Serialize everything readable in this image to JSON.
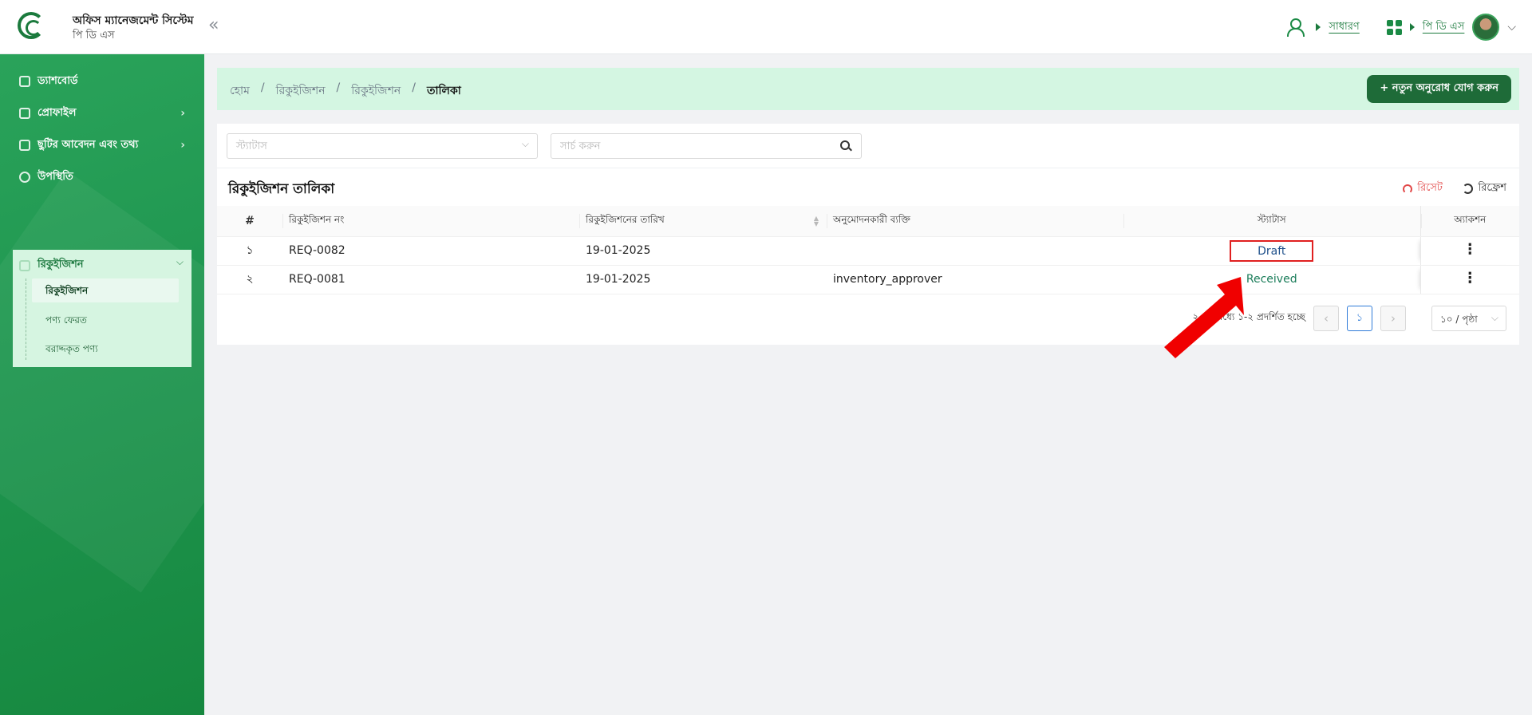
{
  "header": {
    "app_title": "অফিস ম্যানেজমেন্ট সিস্টেম",
    "app_subtitle": "পি ডি এস",
    "role_link": "সাধারণ",
    "module_link": "পি ডি এস"
  },
  "sidebar": {
    "items": [
      {
        "label": "ড্যাশবোর্ড"
      },
      {
        "label": "প্রোফাইল"
      },
      {
        "label": "ছুটির আবেদন এবং তথ্য"
      },
      {
        "label": "উপস্থিতি"
      },
      {
        "label": "রিকুইজিশন"
      }
    ],
    "sub_items": [
      {
        "label": "রিকুইজিশন"
      },
      {
        "label": "পণ্য ফেরত"
      },
      {
        "label": "বরাদ্দকৃত পণ্য"
      }
    ]
  },
  "breadcrumb": [
    "হোম",
    "রিকুইজিশন",
    "রিকুইজিশন",
    "তালিকা"
  ],
  "breadcrumb_sep": "/",
  "add_button": "+ নতুন অনুরোধ যোগ করুন",
  "filters": {
    "status_placeholder": "স্ট্যাটাস",
    "search_placeholder": "সার্চ করুন"
  },
  "card": {
    "title": "রিকুইজিশন তালিকা",
    "reset_label": "রিসেট",
    "refresh_label": "রিফ্রেশ"
  },
  "table": {
    "columns": [
      "#",
      "রিকুইজিশন নং",
      "রিকুইজিশনের তারিখ",
      "অনুমোদনকারী ব্যক্তি",
      "স্ট্যাটাস",
      "অ্যাকশন"
    ],
    "rows": [
      {
        "num": "১",
        "req_no": "REQ-0082",
        "date": "19-01-2025",
        "approver": "",
        "status": "Draft"
      },
      {
        "num": "২",
        "req_no": "REQ-0081",
        "date": "19-01-2025",
        "approver": "inventory_approver",
        "status": "Received"
      }
    ],
    "action_glyph": "⋮"
  },
  "pagination": {
    "summary": "২ এর মধ্যে ১-২ প্রদর্শিত হচ্ছে",
    "current_page": "১",
    "page_size": "১০ / পৃষ্ঠা"
  },
  "colors": {
    "brand_green": "#1e6b38",
    "sidebar_green": "#1f9650",
    "highlight_red": "#e02020"
  }
}
